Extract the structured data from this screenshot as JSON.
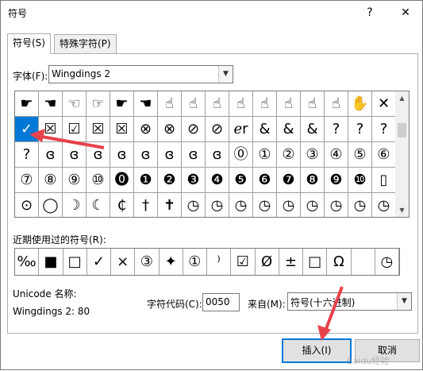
{
  "window": {
    "title": "符号",
    "help_label": "?",
    "close_label": "✕"
  },
  "tabs": [
    {
      "label": "符号(S)"
    },
    {
      "label": "特殊字符(P)"
    }
  ],
  "font": {
    "label": "字体(F):",
    "value": "Wingdings 2"
  },
  "symbol_grid": {
    "rows": [
      [
        "☛",
        "☚",
        "☜",
        "☞",
        "☛",
        "☚",
        "☝",
        "☝",
        "☝",
        "☝",
        "☝",
        "☝",
        "☝",
        "☝",
        "✋",
        "✕"
      ],
      [
        "✓",
        "☒",
        "☑",
        "☒",
        "☒",
        "⊗",
        "⊗",
        "⊘",
        "⊘",
        "ℯr",
        "&",
        "&",
        "&",
        "?",
        "?",
        "?"
      ],
      [
        "?",
        "ɞ",
        "ɞ",
        "ɞ",
        "ɞ",
        "ɞ",
        "ɞ",
        "ɞ",
        "ɞ",
        "⓪",
        "①",
        "②",
        "③",
        "④",
        "⑤",
        "⑥"
      ],
      [
        "⑦",
        "⑧",
        "⑨",
        "⑩",
        "⓿",
        "❶",
        "❷",
        "❸",
        "❹",
        "❺",
        "❻",
        "❼",
        "❽",
        "❾",
        "❿",
        "▯"
      ],
      [
        "⊙",
        "◯",
        "☽",
        "☾",
        "₵",
        "†",
        "✝",
        "◷",
        "◷",
        "◷",
        "◷",
        "◷",
        "◷",
        "◷",
        "◷",
        "◷"
      ]
    ],
    "selected_symbol": "✓"
  },
  "recent": {
    "label": "近期使用过的符号(R):",
    "symbols": [
      "‰",
      "■",
      "□",
      "✓",
      "×",
      "③",
      "✦",
      "①",
      "⁾",
      "☑",
      "Ø",
      "±",
      "□",
      "Ω",
      "",
      "◷"
    ]
  },
  "unicode": {
    "name_label": "Unicode 名称:",
    "name_value": "Wingdings 2: 80"
  },
  "char_code": {
    "label": "字符代码(C):",
    "value": "0050"
  },
  "from": {
    "label": "来自(M):",
    "value": "符号(十六进制)"
  },
  "buttons": {
    "insert": "插入(I)",
    "cancel": "取消"
  },
  "watermark": "Baidu经验",
  "colors": {
    "accent": "#0078d7",
    "annotation_arrow": "#e8424b"
  }
}
